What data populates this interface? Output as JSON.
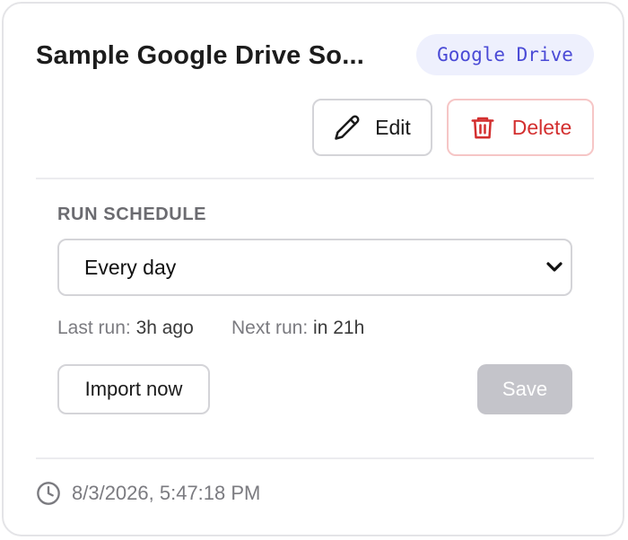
{
  "card": {
    "title": "Sample Google Drive So...",
    "source_badge": "Google Drive"
  },
  "actions": {
    "edit_label": "Edit",
    "delete_label": "Delete"
  },
  "schedule": {
    "section_label": "RUN SCHEDULE",
    "selected_option": "Every day",
    "last_run_label": "Last run:",
    "last_run_value": "3h ago",
    "next_run_label": "Next run:",
    "next_run_value": "in 21h",
    "import_now_label": "Import now",
    "save_label": "Save"
  },
  "footer": {
    "timestamp": "8/3/2026, 5:47:18 PM"
  },
  "icons": {
    "edit": "pencil-icon",
    "delete": "trash-icon",
    "dropdown": "chevron-down-icon",
    "timestamp": "clock-icon"
  },
  "colors": {
    "badge_bg": "#eef0fd",
    "badge_text": "#4a4ad6",
    "danger": "#d32f2f",
    "danger_border": "#f6c6c6",
    "disabled_button": "#c4c4ca"
  }
}
